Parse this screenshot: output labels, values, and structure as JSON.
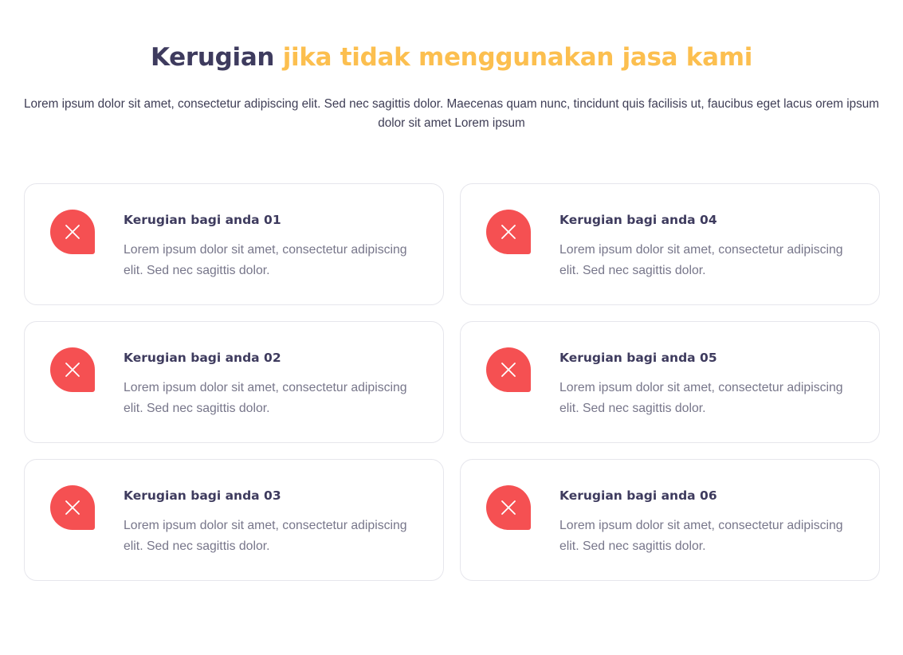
{
  "header": {
    "title_part1": "Kerugian",
    "title_part2": "jika tidak menggunakan jasa kami",
    "description": "Lorem ipsum dolor sit amet, consectetur adipiscing elit. Sed nec sagittis dolor. Maecenas quam nunc, tincidunt quis facilisis ut, faucibus eget lacus orem ipsum dolor sit amet Lorem ipsum"
  },
  "colors": {
    "dark": "#3e3b5e",
    "accent": "#fcbf4f",
    "icon_bg": "#f55052"
  },
  "cards": [
    {
      "icon": "close-icon",
      "title": "Kerugian bagi anda 01",
      "text": "Lorem ipsum dolor sit amet, consectetur adipiscing elit. Sed nec sagittis dolor."
    },
    {
      "icon": "close-icon",
      "title": "Kerugian bagi anda 02",
      "text": "Lorem ipsum dolor sit amet, consectetur adipiscing elit. Sed nec sagittis dolor."
    },
    {
      "icon": "close-icon",
      "title": "Kerugian bagi anda 03",
      "text": "Lorem ipsum dolor sit amet, consectetur adipiscing elit. Sed nec sagittis dolor."
    },
    {
      "icon": "close-icon",
      "title": "Kerugian bagi anda 04",
      "text": "Lorem ipsum dolor sit amet, consectetur adipiscing elit. Sed nec sagittis dolor."
    },
    {
      "icon": "close-icon",
      "title": "Kerugian bagi anda 05",
      "text": "Lorem ipsum dolor sit amet, consectetur adipiscing elit. Sed nec sagittis dolor."
    },
    {
      "icon": "close-icon",
      "title": "Kerugian bagi anda 06",
      "text": "Lorem ipsum dolor sit amet, consectetur adipiscing elit. Sed nec sagittis dolor."
    }
  ]
}
